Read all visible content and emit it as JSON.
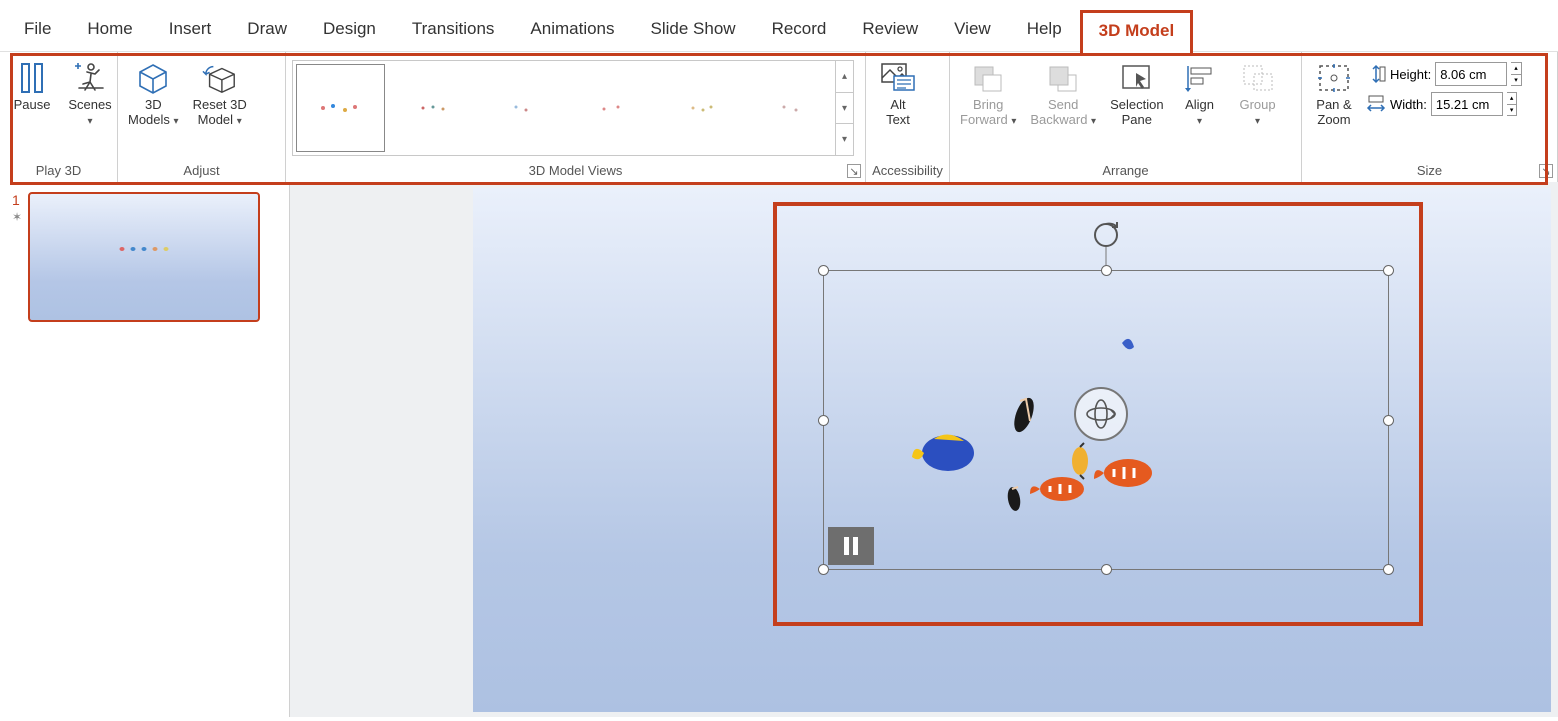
{
  "menu": {
    "tabs": [
      "File",
      "Home",
      "Insert",
      "Draw",
      "Design",
      "Transitions",
      "Animations",
      "Slide Show",
      "Record",
      "Review",
      "View",
      "Help",
      "3D Model"
    ],
    "active": "3D Model"
  },
  "ribbon": {
    "groups": {
      "play3d": {
        "label": "Play 3D",
        "pause": "Pause",
        "scenes": "Scenes"
      },
      "adjust": {
        "label": "Adjust",
        "models": "3D\nModels",
        "reset": "Reset 3D\nModel"
      },
      "views": {
        "label": "3D Model Views"
      },
      "accessibility": {
        "label": "Accessibility",
        "alt": "Alt\nText"
      },
      "arrange": {
        "label": "Arrange",
        "bringfwd": "Bring\nForward",
        "sendback": "Send\nBackward",
        "selpane": "Selection\nPane",
        "align": "Align",
        "group": "Group"
      },
      "size": {
        "label": "Size",
        "panzoom": "Pan &\nZoom",
        "height_label": "Height:",
        "height_value": "8.06 cm",
        "width_label": "Width:",
        "width_value": "15.21 cm"
      }
    }
  },
  "thumbs": {
    "index": "1"
  }
}
